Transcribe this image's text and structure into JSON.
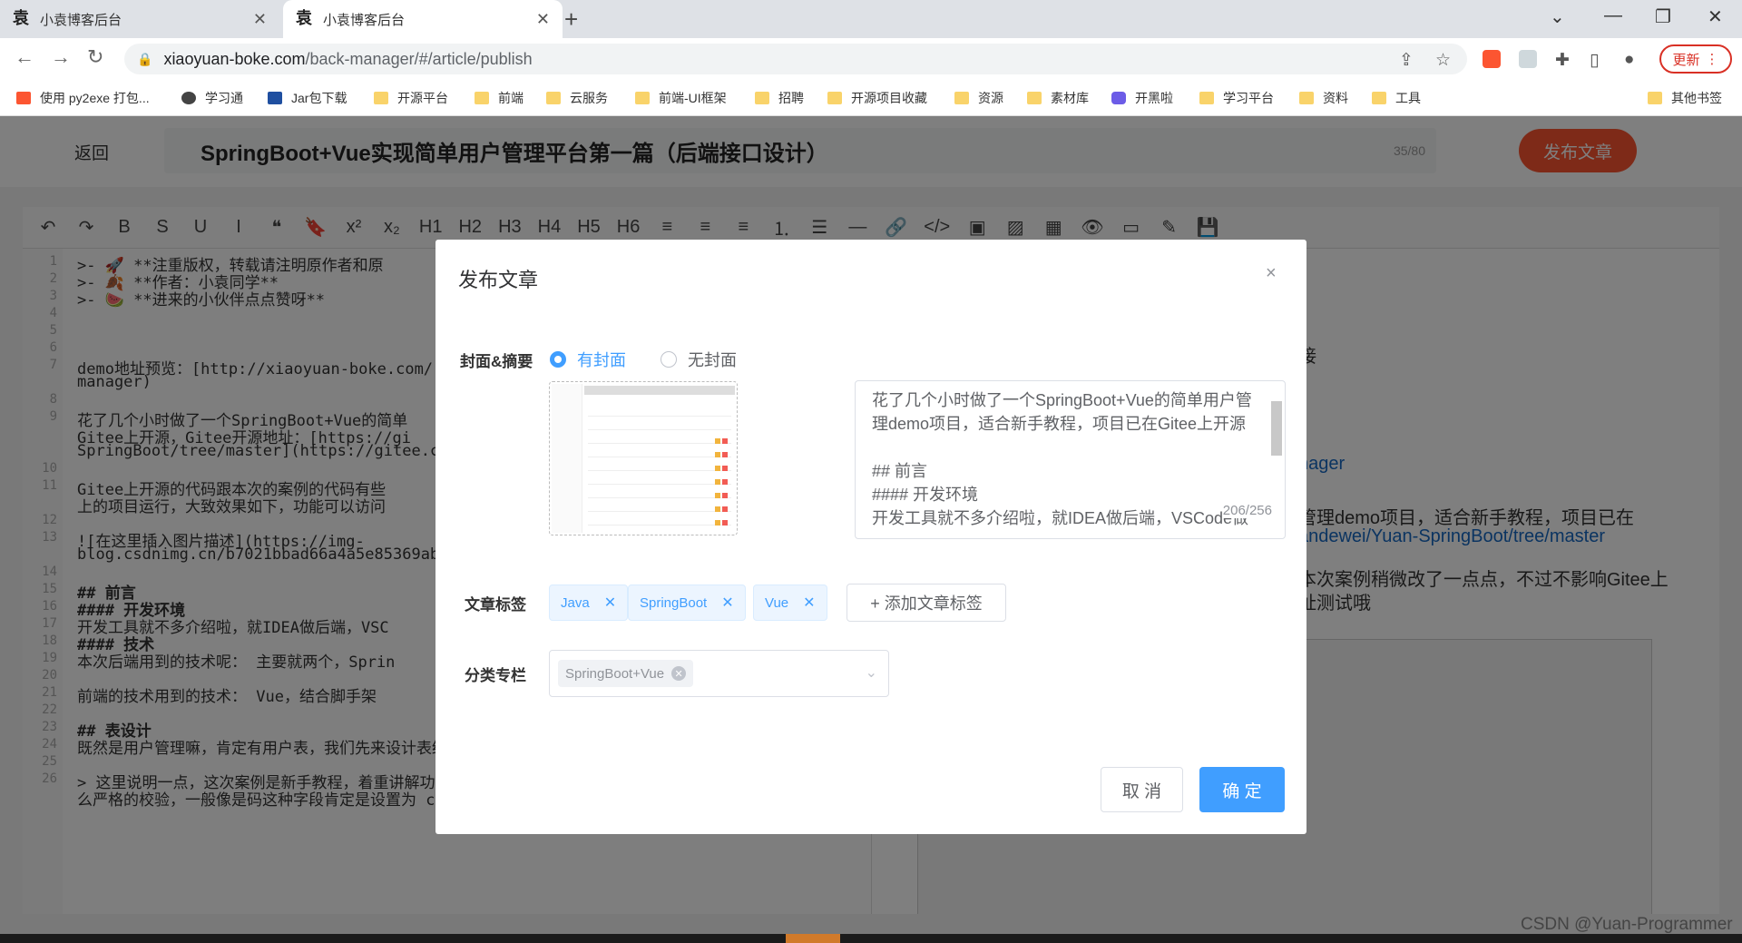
{
  "browser": {
    "tabs": [
      {
        "label": "小袁博客后台",
        "icon": "site-favicon"
      },
      {
        "label": "小袁博客后台",
        "icon": "site-favicon"
      }
    ],
    "new_tab": "+",
    "url_host": "xiaoyuan-boke.com",
    "url_path": "/back-manager/#/article/publish",
    "update_label": "更新",
    "window_controls": {
      "chevron": "⌄",
      "minimize": "—",
      "maximize": "❐",
      "close": "✕"
    },
    "bookmarks": [
      {
        "label": "使用 py2exe 打包...",
        "icon": "csdn-icon",
        "color": "#fc5531"
      },
      {
        "label": "学习通",
        "icon": "globe-icon",
        "color": "#444444"
      },
      {
        "label": "Jar包下载",
        "icon": "mvn-icon",
        "color": "#1f4fa0"
      },
      {
        "label": "开源平台",
        "icon": "folder-icon"
      },
      {
        "label": "前端",
        "icon": "folder-icon"
      },
      {
        "label": "云服务",
        "icon": "folder-icon"
      },
      {
        "label": "前端-UI框架",
        "icon": "folder-icon"
      },
      {
        "label": "招聘",
        "icon": "folder-icon"
      },
      {
        "label": "开源项目收藏",
        "icon": "folder-icon"
      },
      {
        "label": "资源",
        "icon": "folder-icon"
      },
      {
        "label": "素材库",
        "icon": "folder-icon"
      },
      {
        "label": "开黑啦",
        "icon": "kaiheila-icon",
        "color": "#6c5ce7"
      },
      {
        "label": "学习平台",
        "icon": "folder-icon"
      },
      {
        "label": "资料",
        "icon": "folder-icon"
      },
      {
        "label": "工具",
        "icon": "folder-icon"
      }
    ],
    "other_bookmarks": "其他书签"
  },
  "page": {
    "back_label": "返回",
    "article_title": "SpringBoot+Vue实现简单用户管理平台第一篇（后端接口设计）",
    "title_count": "35/80",
    "publish_label": "发布文章",
    "toolbar_icons": [
      "↶",
      "↷",
      "B",
      "S",
      "U",
      "I",
      "❝",
      "🔖",
      "x²",
      "x₂",
      "H1",
      "H2",
      "H3",
      "H4",
      "H5",
      "H6",
      "≡",
      "≡",
      "≡",
      "⒈",
      "☰",
      "—",
      "🔗",
      "</>",
      "▣",
      "▨",
      "▦",
      "👁",
      "▭",
      "✎",
      "💾"
    ],
    "code_lines": [
      {
        "n": "1",
        "text": ">- 🚀 **注重版权，转载请注明原作者和原"
      },
      {
        "n": "2",
        "text": ">- 🍂 **作者：小袁同学**"
      },
      {
        "n": "3",
        "text": ">- 🍉 **进来的小伙伴点点赞呀**"
      },
      {
        "n": "4",
        "text": ""
      },
      {
        "n": "5",
        "text": ""
      },
      {
        "n": "6",
        "text": ""
      },
      {
        "n": "7",
        "text": "demo地址预览：[http://xiaoyuan-boke.com/"
      },
      {
        "n": "",
        "text": "manager)"
      },
      {
        "n": "8",
        "text": ""
      },
      {
        "n": "9",
        "text": "花了几个小时做了一个SpringBoot+Vue的简单"
      },
      {
        "n": "",
        "text": "Gitee上开源，Gitee开源地址：[https://gi"
      },
      {
        "n": "",
        "text": "SpringBoot/tree/master](https://gitee.c"
      },
      {
        "n": "10",
        "text": ""
      },
      {
        "n": "11",
        "text": "Gitee上开源的代码跟本次的案例的代码有些"
      },
      {
        "n": "",
        "text": "上的项目运行，大致效果如下，功能可以访问"
      },
      {
        "n": "12",
        "text": ""
      },
      {
        "n": "13",
        "text": "![在这里插入图片描述](https://img-"
      },
      {
        "n": "",
        "text": "blog.csdnimg.cn/b7021bbad66a4a5e85369ab7"
      },
      {
        "n": "14",
        "text": ""
      },
      {
        "n": "15",
        "text": "## 前言"
      },
      {
        "n": "16",
        "text": "#### 开发环境"
      },
      {
        "n": "17",
        "text": "开发工具就不多介绍啦，就IDEA做后端，VSC"
      },
      {
        "n": "18",
        "text": "#### 技术"
      },
      {
        "n": "19",
        "text": "本次后端用到的技术呢： 主要就两个，Sprin"
      },
      {
        "n": "20",
        "text": ""
      },
      {
        "n": "21",
        "text": " 前端的技术用到的技术： Vue，结合脚手架"
      },
      {
        "n": "22",
        "text": ""
      },
      {
        "n": "23",
        "text": "## 表设计"
      },
      {
        "n": "24",
        "text": "既然是用户管理嘛，肯定有用户表，我们先来设计表结构"
      },
      {
        "n": "25",
        "text": ""
      },
      {
        "n": "26",
        "text": "> 这里说明一点，这次案例是新手教程，着重讲解功能的实现，所以用户信息参数方面就没有那"
      },
      {
        "n": "",
        "text": "么严格的校验，一般像是码这种字段肯定是设置为 char(11) 并且后端要校验的"
      }
    ],
    "preview_lines": [
      {
        "text": "接"
      },
      {
        "text": "nager",
        "link": true
      },
      {
        "text": "管理demo项目，适合新手教程，项目已在"
      },
      {
        "text": "andewei/Yuan-SpringBoot/tree/master",
        "link": true
      },
      {
        "text": "本次案例稍微改了一点点，不过不影响Gitee上"
      },
      {
        "text": "址测试哦"
      }
    ]
  },
  "dialog": {
    "title": "发布文章",
    "close_icon": "×",
    "cover_label": "封面&摘要",
    "cover_options": [
      {
        "label": "有封面",
        "selected": true
      },
      {
        "label": "无封面",
        "selected": false
      }
    ],
    "abstract_text": "花了几个小时做了一个SpringBoot+Vue的简单用户管理demo项目，适合新手教程，项目已在Gitee上开源\n\n## 前言\n#### 开发环境\n开发工具就不多介绍啦，就IDEA做后端，VSCode做",
    "abstract_count": "206/256",
    "tags_label": "文章标签",
    "tags": [
      "Java",
      "SpringBoot",
      "Vue"
    ],
    "add_tag_label": "+ 添加文章标签",
    "category_label": "分类专栏",
    "category_value": "SpringBoot+Vue",
    "cancel_label": "取 消",
    "ok_label": "确 定"
  },
  "watermark": "CSDN @Yuan-Programmer",
  "colors": {
    "primary": "#409eff",
    "publish": "#fc5531",
    "update_red": "#d93025"
  }
}
